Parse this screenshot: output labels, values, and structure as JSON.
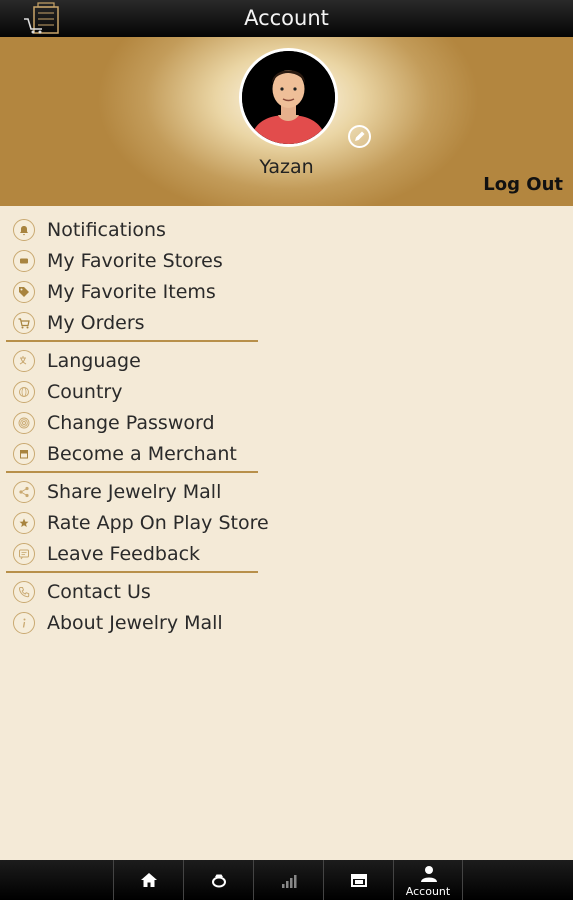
{
  "header": {
    "title": "Account"
  },
  "profile": {
    "name": "Yazan",
    "logout_label": "Log Out"
  },
  "menu": {
    "group1": [
      {
        "label": "Notifications",
        "icon": "bell-icon"
      },
      {
        "label": "My Favorite Stores",
        "icon": "store-icon"
      },
      {
        "label": "My Favorite Items",
        "icon": "tag-icon"
      },
      {
        "label": "My Orders",
        "icon": "cart-icon"
      }
    ],
    "group2": [
      {
        "label": "Language",
        "icon": "language-icon"
      },
      {
        "label": "Country",
        "icon": "globe-icon"
      },
      {
        "label": "Change Password",
        "icon": "fingerprint-icon"
      },
      {
        "label": "Become a Merchant",
        "icon": "shop-icon"
      }
    ],
    "group3": [
      {
        "label": "Share Jewelry Mall",
        "icon": "share-icon"
      },
      {
        "label": "Rate App On Play Store",
        "icon": "star-icon"
      },
      {
        "label": "Leave Feedback",
        "icon": "feedback-icon"
      }
    ],
    "group4": [
      {
        "label": "Contact Us",
        "icon": "phone-icon"
      },
      {
        "label": "About Jewelry Mall",
        "icon": "info-icon"
      }
    ]
  },
  "bottom_nav": {
    "items": [
      {
        "icon": "home-icon"
      },
      {
        "icon": "ring-icon"
      },
      {
        "icon": "chart-icon"
      },
      {
        "icon": "store-icon"
      },
      {
        "icon": "account-icon",
        "label": "Account"
      }
    ]
  },
  "colors": {
    "accent": "#b8904a",
    "background": "#f4ead7",
    "bar": "#000000"
  }
}
